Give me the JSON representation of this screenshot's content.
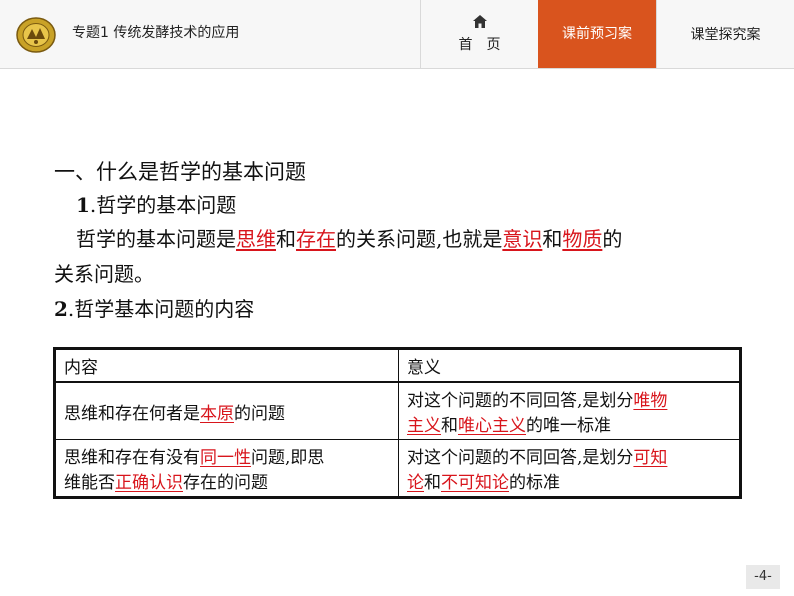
{
  "header": {
    "breadcrumb": "专题1  传统发酵技术的应用",
    "nav": {
      "home_label": "首　页",
      "pre_class_label": "课前预习案",
      "in_class_label": "课堂探究案"
    }
  },
  "section": {
    "heading": "一、什么是哲学的基本问题",
    "sub1": {
      "num": "1",
      "text": ".哲学的基本问题"
    },
    "para": {
      "p1": "哲学的基本问题是",
      "b1": "思维",
      "p2": "和",
      "b2": "存在",
      "p3": "的关系问题,也就是",
      "b3": "意识",
      "p4": "和",
      "b4": "物质",
      "p5": "的",
      "line2": "关系问题。"
    },
    "sub2": {
      "num": "2",
      "text": ".哲学基本问题的内容"
    }
  },
  "table": {
    "headers": [
      "内容",
      "意义"
    ],
    "rows": [
      {
        "c1": {
          "a": "思维和存在何者是",
          "b": "本原",
          "c": "的问题"
        },
        "c2": {
          "a": "对这个问题的不同回答,是划分",
          "b": "唯物",
          "c": "主义",
          "d": "和",
          "e": "唯心主义",
          "f": "的唯一标准"
        }
      },
      {
        "c1": {
          "a": "思维和存在有没有",
          "b": "同一性",
          "c": "问题,即思",
          "d": "维能否",
          "e": "正确认识",
          "f": "存在的问题"
        },
        "c2": {
          "a": "对这个问题的不同回答,是划分",
          "b": "可知",
          "c": "论",
          "d": "和",
          "e": "不可知论",
          "f": "的标准"
        }
      }
    ]
  },
  "footer": {
    "page_number": "-4-"
  },
  "colors": {
    "accent": "#d9541e",
    "answer_red": "#d8151c"
  }
}
